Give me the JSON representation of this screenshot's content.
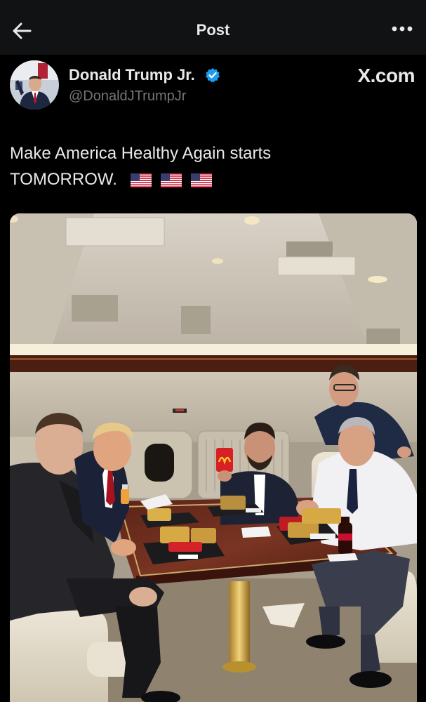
{
  "header": {
    "title": "Post",
    "back_icon": "arrow-left-icon",
    "more_icon": "more-dots-icon"
  },
  "author": {
    "name": "Donald Trump Jr.",
    "handle": "@DonaldJTrumpJr",
    "verified": true,
    "verified_color": "#1d9bf0"
  },
  "watermark": "X.com",
  "post": {
    "text_line1": "Make America Healthy Again starts",
    "text_line2": "TOMORROW.",
    "emoji": [
      "us-flag",
      "us-flag",
      "us-flag"
    ]
  },
  "colors": {
    "background": "#000000",
    "header_background": "#111214",
    "text_primary": "#e7e9ea",
    "text_secondary": "#71767b"
  }
}
